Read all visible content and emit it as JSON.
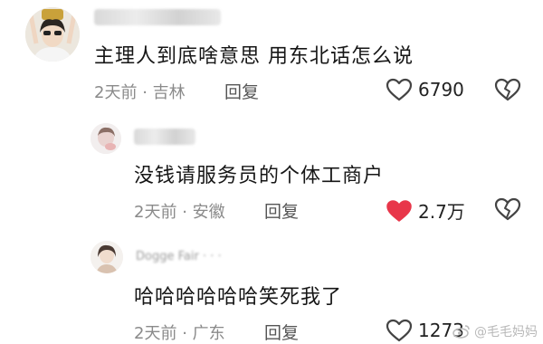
{
  "comments": [
    {
      "text": "主理人到底啥意思  用东北话怎么说",
      "time": "2天前",
      "location": "吉林",
      "reply_label": "回复",
      "like_count": "6790",
      "liked": false
    },
    {
      "text": "没钱请服务员的个体工商户",
      "time": "2天前",
      "location": "安徽",
      "reply_label": "回复",
      "like_count": "2.7万",
      "liked": true
    },
    {
      "text": "哈哈哈哈哈哈笑死我了",
      "time": "2天前",
      "location": "广东",
      "reply_label": "回复",
      "like_count": "1273",
      "liked": false
    }
  ],
  "colors": {
    "liked": "#e8364a",
    "icon": "#444444",
    "meta": "#8a8a8a"
  },
  "watermark": "@毛毛妈妈"
}
